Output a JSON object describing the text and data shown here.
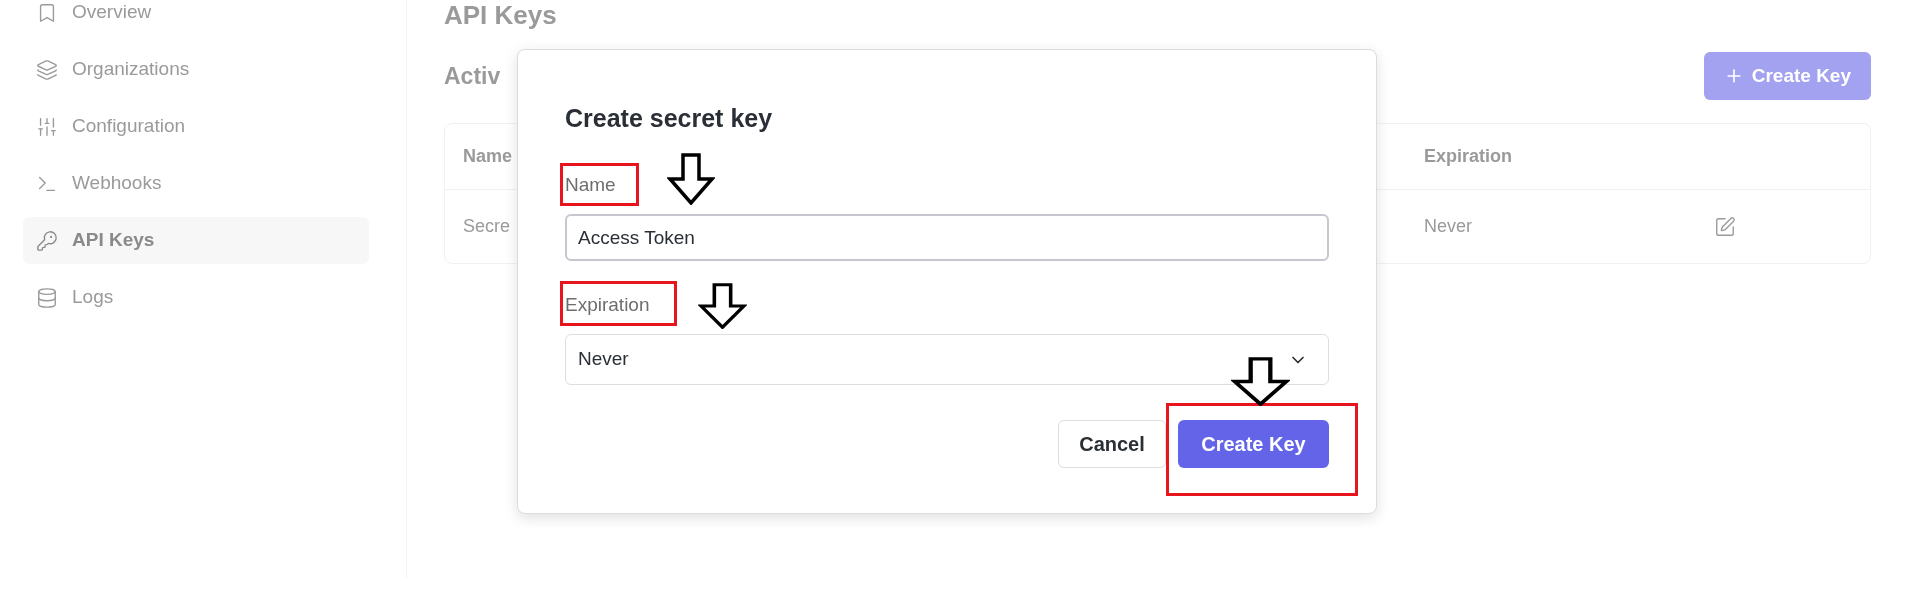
{
  "sidebar": {
    "items": [
      {
        "label": "Overview",
        "selected": false
      },
      {
        "label": "Organizations",
        "selected": false
      },
      {
        "label": "Configuration",
        "selected": false
      },
      {
        "label": "Webhooks",
        "selected": false
      },
      {
        "label": "API Keys",
        "selected": true
      },
      {
        "label": "Logs",
        "selected": false
      }
    ]
  },
  "page": {
    "title": "API Keys",
    "section_title": "Activ",
    "create_button": "Create Key",
    "table": {
      "columns": [
        "Name",
        "Expiration"
      ],
      "rows": [
        {
          "name": "Secre",
          "expiration": "Never"
        }
      ]
    }
  },
  "dialog": {
    "title": "Create secret key",
    "fields": [
      {
        "kind": "text",
        "label": "Name",
        "value": "Access Token"
      },
      {
        "kind": "select",
        "label": "Expiration",
        "value": "Never"
      }
    ],
    "buttons": [
      {
        "label": "Cancel",
        "primary": false
      },
      {
        "label": "Create Key",
        "primary": true
      }
    ]
  }
}
